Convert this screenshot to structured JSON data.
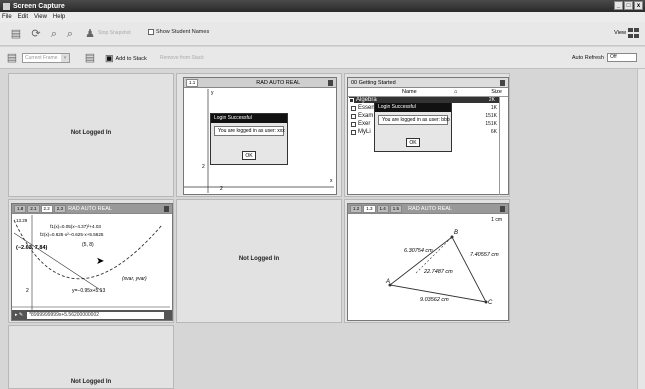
{
  "window": {
    "title": "Screen Capture",
    "controls": [
      "_",
      "□",
      "x"
    ]
  },
  "menu": [
    "File",
    "Edit",
    "View",
    "Help"
  ],
  "toolbar1": {
    "faded_label": "Stop Snapshot",
    "show_student_names": "Show Student Names",
    "view_label": "View"
  },
  "toolbar2": {
    "frame_select": "Current Frame",
    "add_to_stack": "Add to Stack",
    "faded_label": "Remove from Stack",
    "auto_refresh_label": "Auto Refresh",
    "auto_refresh_value": "Off"
  },
  "tiles": {
    "not_logged_in": "Not Logged In"
  },
  "screen1": {
    "tab": "1.1",
    "mode": "RAD AUTO REAL",
    "y_label": "y",
    "x_label": "x",
    "tick": "2",
    "dialog": {
      "title": "Login Successful",
      "message": "You are logged in as user: xxx",
      "ok": "OK"
    }
  },
  "screen2": {
    "title": "00 Getting Started",
    "col_name": "Name",
    "col_size": "Size",
    "files": [
      {
        "name": "Algebra",
        "size": "2K"
      },
      {
        "name": "Essenti",
        "size": "1K"
      },
      {
        "name": "Exam",
        "size": "151K"
      },
      {
        "name": "Exer",
        "size": "151K"
      },
      {
        "name": "MyLi",
        "size": "6K"
      }
    ],
    "dialog": {
      "title": "Login Successful",
      "message": "You are logged in as user: bbb",
      "ok": "OK"
    }
  },
  "screen3": {
    "tabs": [
      "1.8",
      "2.1",
      "2.2",
      "2.3"
    ],
    "mode": "RAD AUTO REAL",
    "f1": "f1(x)=0.05(x−4.37)²+4.03",
    "f2": "f2(x)=0.625·x²−0.625·x+5.5625",
    "point": "(−2.63, 7.84)",
    "point2": "(5, 8)",
    "label_y": "13.29",
    "line": "y=−0.95x+5.13",
    "xvar": "(xvar, yvar)",
    "tick": "2",
    "entry": "*8999999999x+5.56200000002"
  },
  "screen4": {
    "tabs": [
      "1.2",
      "1.3",
      "1.4",
      "1.5"
    ],
    "mode": "RAD AUTO REAL",
    "scale": "1 cm",
    "d1": "6.30754 cm",
    "d2": "7.40557 cm",
    "d3": "22.7487 cm",
    "d4": "9.03562 cm",
    "A": "A",
    "B": "B",
    "C": "C"
  }
}
